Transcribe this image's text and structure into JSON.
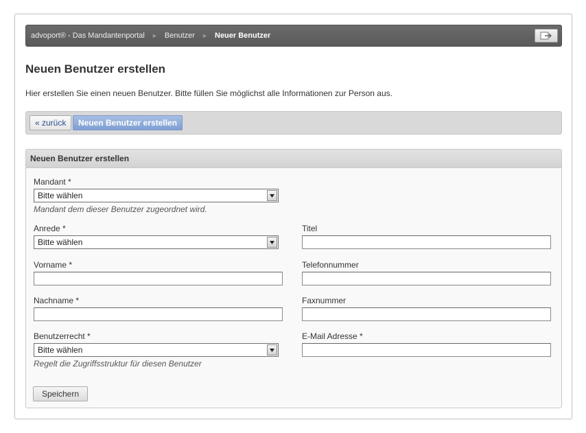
{
  "breadcrumb": {
    "items": [
      {
        "label": "advoport® - Das Mandantenportal"
      },
      {
        "label": "Benutzer"
      },
      {
        "label": "Neuer Benutzer"
      }
    ]
  },
  "page": {
    "title": "Neuen Benutzer erstellen",
    "intro": "Hier erstellen Sie einen neuen Benutzer. Bitte füllen Sie möglichst alle Informationen zur Person aus."
  },
  "toolbar": {
    "back_label": "« zurück",
    "active_label": "Neuen Benutzer erstellen"
  },
  "form": {
    "header": "Neuen Benutzer erstellen",
    "mandant": {
      "label": "Mandant *",
      "value": "Bitte wählen",
      "hint": "Mandant dem dieser Benutzer zugeordnet wird."
    },
    "anrede": {
      "label": "Anrede *",
      "value": "Bitte wählen"
    },
    "titel": {
      "label": "Titel",
      "value": ""
    },
    "vorname": {
      "label": "Vorname *",
      "value": ""
    },
    "telefon": {
      "label": "Telefonnummer",
      "value": ""
    },
    "nachname": {
      "label": "Nachname *",
      "value": ""
    },
    "fax": {
      "label": "Faxnummer",
      "value": ""
    },
    "benutzerrecht": {
      "label": "Benutzerrecht *",
      "value": "Bitte wählen",
      "hint": "Regelt die Zugriffsstruktur für diesen Benutzer"
    },
    "email": {
      "label": "E-Mail Adresse *",
      "value": ""
    },
    "save_label": "Speichern"
  },
  "icons": {
    "logout": "logout-icon",
    "breadcrumb_separator": "chevron-right-icon",
    "select_arrow": "chevron-down-icon"
  },
  "colors": {
    "breadcrumb_bg": "#5f5f5f",
    "active_button": "#8fadd9",
    "link_blue": "#2a4d8f"
  }
}
